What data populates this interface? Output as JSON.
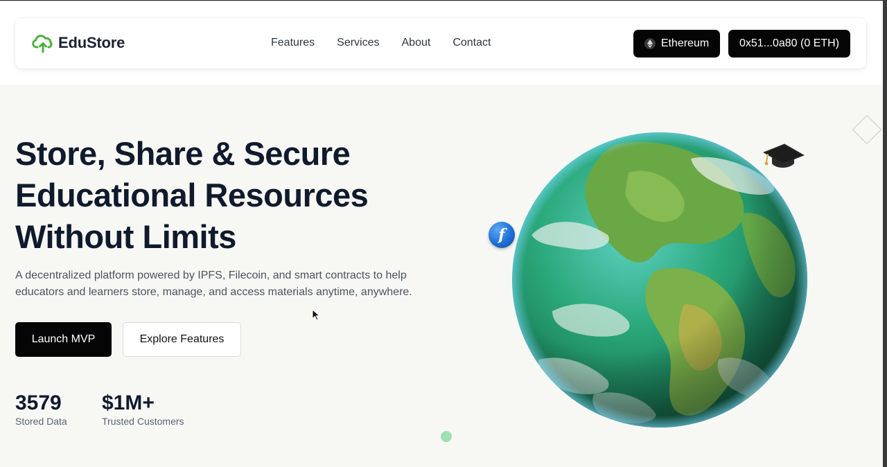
{
  "brand": {
    "name": "EduStore",
    "logo_icon": "cloud-upload-icon",
    "accent": "#4caf3d"
  },
  "nav": {
    "links": [
      "Features",
      "Services",
      "About",
      "Contact"
    ]
  },
  "header_actions": {
    "network_label": "Ethereum",
    "network_icon": "ethereum-icon",
    "wallet_label": "0x51...0a80 (0 ETH)"
  },
  "hero": {
    "title_line1": "Store, Share & Secure",
    "title_line2": "Educational Resources",
    "title_line3": "Without Limits",
    "subtitle_line1": "A decentralized platform powered by IPFS, Filecoin, and smart contracts to help",
    "subtitle_line2": "educators and learners store, manage, and access materials anytime, anywhere.",
    "primary_cta": "Launch MVP",
    "secondary_cta": "Explore Features"
  },
  "stats": [
    {
      "value": "3579",
      "label": "Stored Data"
    },
    {
      "value": "$1M+",
      "label": "Trusted Customers"
    }
  ],
  "decor": {
    "filecoin_symbol": "f",
    "globe_icon": "earth-globe-icon",
    "cap_icon": "graduation-cap-icon"
  }
}
